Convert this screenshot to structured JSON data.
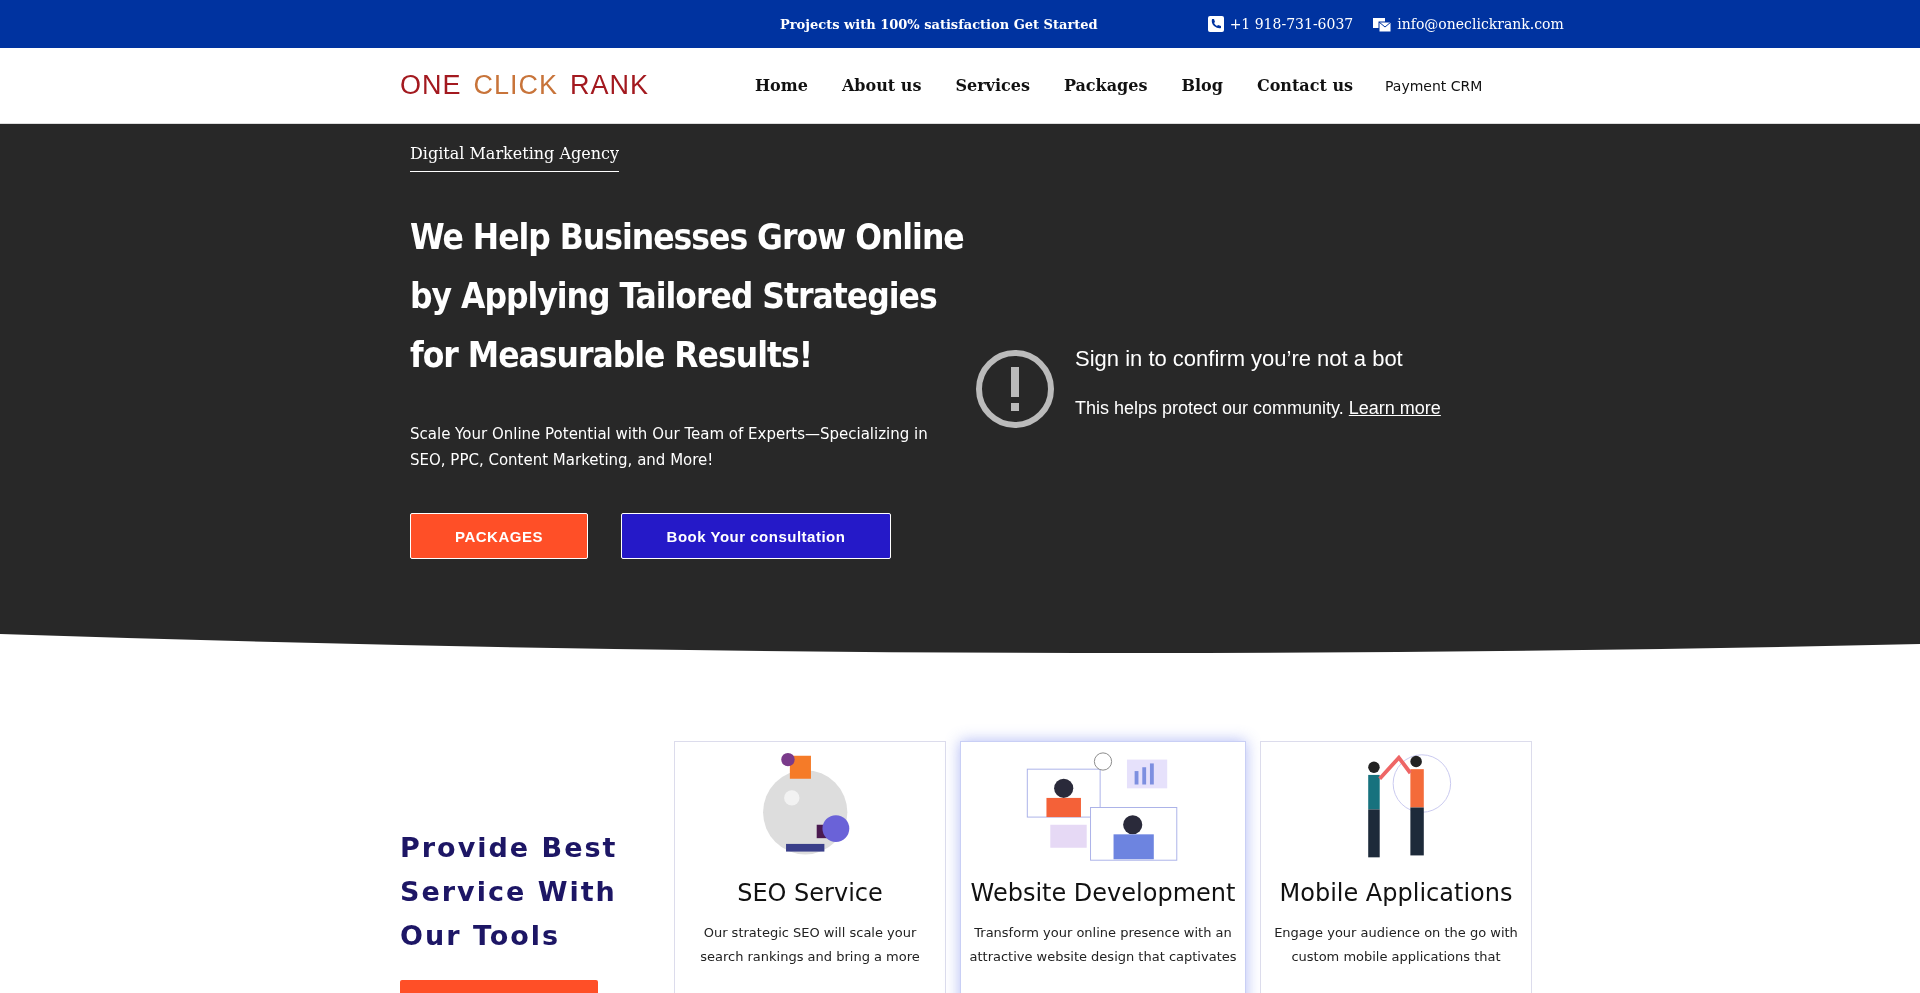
{
  "top_bar": {
    "promo": "Projects with 100% satisfaction Get Started",
    "phone": "+1 918-731-6037",
    "email": "info@oneclickrank.com"
  },
  "header": {
    "logo": [
      {
        "text": "ONE",
        "color": "#a3191f"
      },
      {
        "text": "CLICK",
        "color": "#c8743a"
      },
      {
        "text": "RANK",
        "color": "#a3191f"
      }
    ],
    "nav": [
      {
        "label": "Home",
        "selected": false
      },
      {
        "label": "About us",
        "selected": false
      },
      {
        "label": "Services",
        "selected": false
      },
      {
        "label": "Packages",
        "selected": false
      },
      {
        "label": "Blog",
        "selected": false
      },
      {
        "label": "Contact us",
        "selected": false
      }
    ],
    "payment_link": "Payment CRM"
  },
  "hero": {
    "eyebrow": "Digital Marketing Agency",
    "headline": [
      "We Help Businesses Grow Online",
      "by Applying Tailored Strategies",
      "for Measurable Results!"
    ],
    "subtitle": "Scale Your Online Potential with Our Team of Experts—Specializing in SEO, PPC, Content Marketing, and More!",
    "buttons": [
      {
        "label": "PACKAGES",
        "kind": "primary"
      },
      {
        "label": "Book Your consultation",
        "kind": "secondary"
      }
    ],
    "video_notice": {
      "title": "Sign in to confirm you’re not a bot",
      "text": "This helps protect our community.",
      "link": "Learn more"
    }
  },
  "services": {
    "heading": "Provide Best Service With Our Tools",
    "cards": [
      {
        "title": "SEO Service",
        "lines": [
          "Our strategic SEO will scale your",
          "search rankings and bring a more"
        ],
        "highlighted": false
      },
      {
        "title": "Website Development",
        "lines": [
          "Transform your online presence with an",
          "attractive website design that captivates"
        ],
        "highlighted": true
      },
      {
        "title": "Mobile Applications",
        "lines": [
          "Engage your audience on the go with",
          "custom mobile applications that"
        ],
        "highlighted": false
      }
    ]
  }
}
